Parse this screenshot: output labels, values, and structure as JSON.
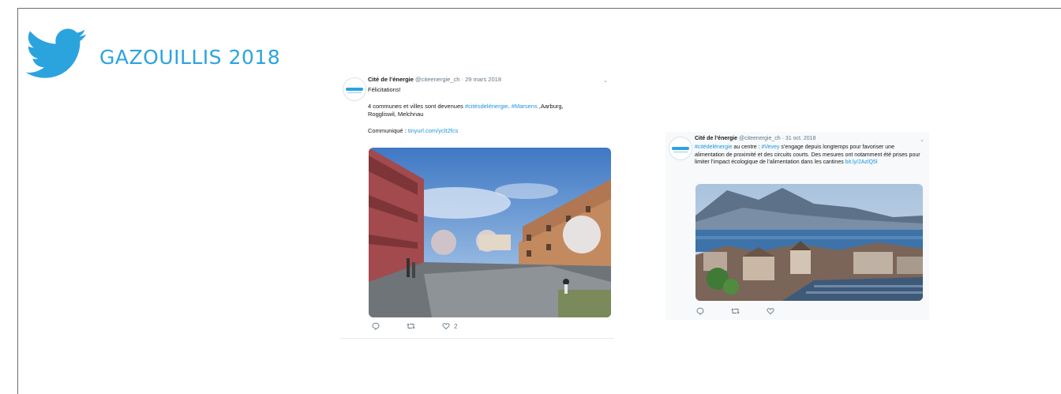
{
  "page": {
    "title": "GAZOUILLIS 2018",
    "colors": {
      "brand_blue": "#2ba4de",
      "link_blue": "#1b95e0",
      "border": "#6d6d6d"
    },
    "logo_icon": "twitter-bird-icon"
  },
  "tweets": [
    {
      "account_name": "Cité de l’énergie",
      "handle": "@citeenergie_ch",
      "separator": "·",
      "date": "29 mars 2018",
      "text_line1": "Félicitations!",
      "text_line2_prefix": "4 communes et villes sont devenues ",
      "hashtag1": "#citésdelénergie",
      "text_line2_mid": ". ",
      "hashtag2": "#Marsens",
      "text_line2_suffix": " ,Aarburg,",
      "text_line3": "Roggliswil, Melchnau",
      "link_label": "Communiqué : ",
      "link": "tinyurl.com/yclt2fcs",
      "media_description_icon": "photo-courtyard",
      "replies_icon": "reply-icon",
      "retweets_icon": "retweet-icon",
      "likes_icon": "heart-icon",
      "likes_count": "2"
    },
    {
      "account_name": "Cité de l’énergie",
      "handle": "@citeenergie_ch",
      "separator": "·",
      "date": "31 oct. 2018",
      "hashtag1": "#citédelénergie",
      "text_a": " au centre : ",
      "hashtag2": "#Vevey",
      "text_b": " s’engage depuis longtemps pour favoriser une alimentation de proximité et des circuits courts. Des mesures ont notamment été prises pour limiter l’impact écologique de l’alimentation dans les cantines ",
      "link": "bit.ly/2AzlQ5l",
      "media_description_icon": "photo-lake-town",
      "replies_icon": "reply-icon",
      "retweets_icon": "retweet-icon",
      "likes_icon": "heart-icon"
    }
  ]
}
